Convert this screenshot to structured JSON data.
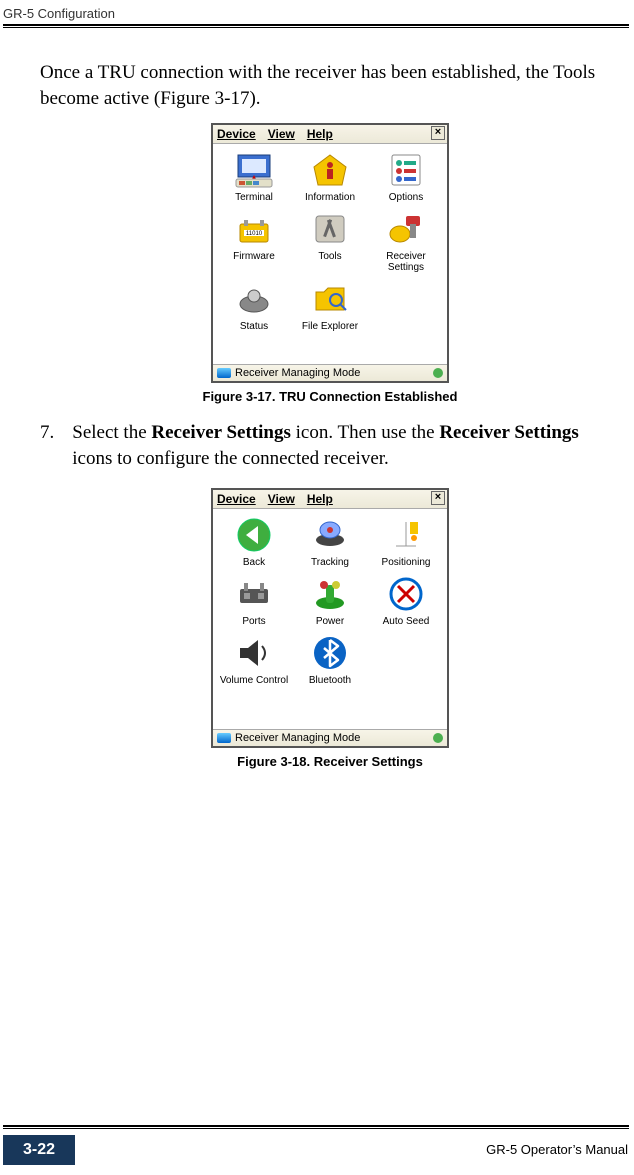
{
  "header": {
    "section": "GR-5 Configuration"
  },
  "body": {
    "intro": "Once a TRU connection with the receiver has been established, the Tools become active (Figure 3-17).",
    "step_num": "7.",
    "step_a": "Select the ",
    "step_b": "Receiver Settings",
    "step_c": " icon. Then use the ",
    "step_d": "Receiver Settings",
    "step_e": " icons to configure the connected receiver."
  },
  "figs": {
    "f17": "Figure 3-17. TRU Connection Established",
    "f18": "Figure 3-18. Receiver Settings"
  },
  "app": {
    "menu": {
      "device": "Device",
      "view": "View",
      "help": "Help",
      "close": "×"
    },
    "status": "Receiver Managing Mode",
    "win1": {
      "items": [
        {
          "label": "Terminal"
        },
        {
          "label": "Information"
        },
        {
          "label": "Options"
        },
        {
          "label": "Firmware"
        },
        {
          "label": "Tools"
        },
        {
          "label": "Receiver Settings"
        },
        {
          "label": "Status"
        },
        {
          "label": "File Explorer"
        }
      ]
    },
    "win2": {
      "items": [
        {
          "label": "Back"
        },
        {
          "label": "Tracking"
        },
        {
          "label": "Positioning"
        },
        {
          "label": "Ports"
        },
        {
          "label": "Power"
        },
        {
          "label": "Auto Seed"
        },
        {
          "label": "Volume Control"
        },
        {
          "label": "Bluetooth"
        }
      ]
    }
  },
  "footer": {
    "page": "3-22",
    "manual": "GR-5 Operator’s Manual"
  }
}
